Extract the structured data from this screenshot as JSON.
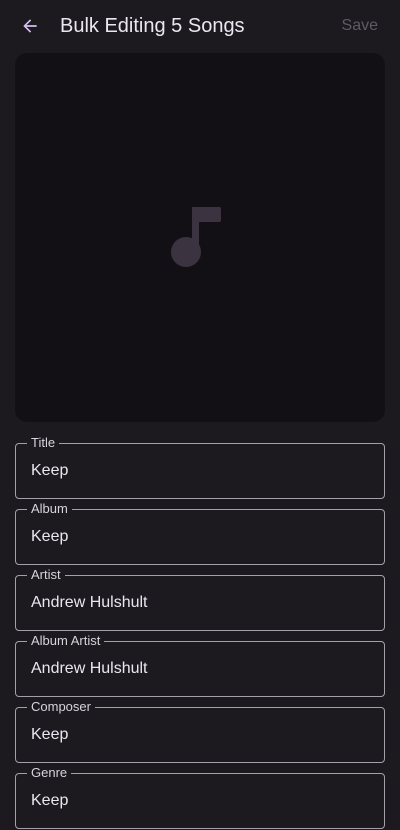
{
  "header": {
    "title": "Bulk Editing 5 Songs",
    "save_label": "Save",
    "back_icon": "arrow-back-icon"
  },
  "artwork": {
    "icon": "music-note-icon",
    "placeholder_color": "#3b3340"
  },
  "fields": [
    {
      "label": "Title",
      "value": "Keep"
    },
    {
      "label": "Album",
      "value": "Keep"
    },
    {
      "label": "Artist",
      "value": "Andrew Hulshult"
    },
    {
      "label": "Album Artist",
      "value": "Andrew Hulshult"
    },
    {
      "label": "Composer",
      "value": "Keep"
    },
    {
      "label": "Genre",
      "value": "Keep"
    }
  ],
  "colors": {
    "background": "#1c1a1f",
    "accent": "#d7bdf3",
    "outline": "#a59fa9"
  }
}
